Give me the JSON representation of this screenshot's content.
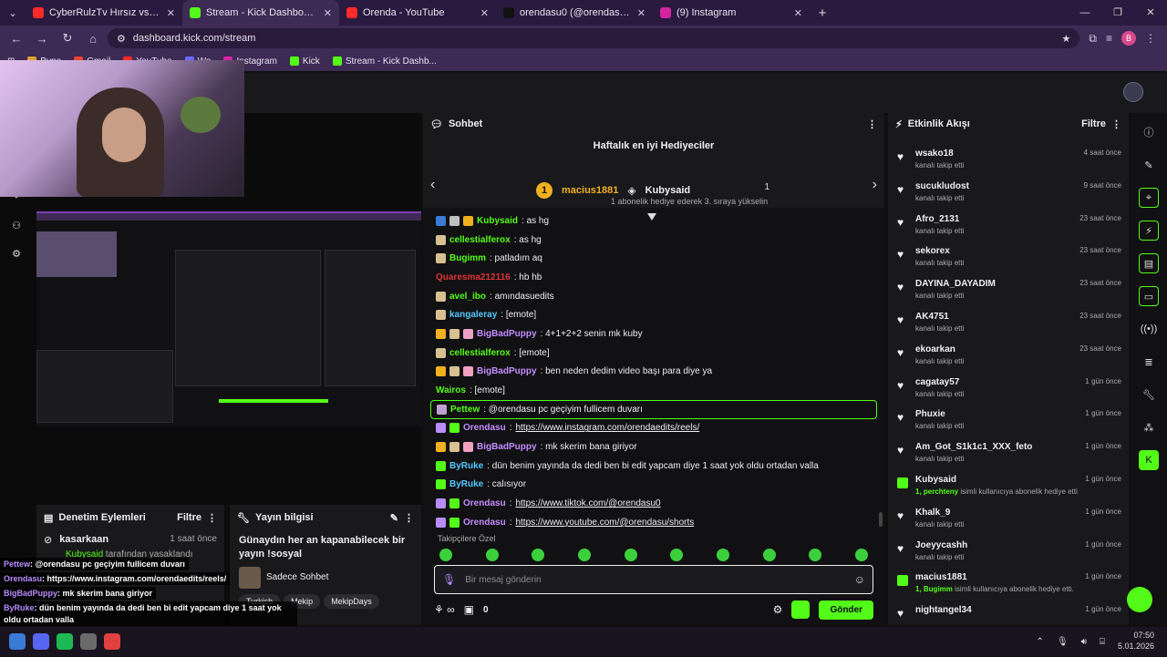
{
  "browser": {
    "tabs": [
      {
        "label": "CyberRulzTv Hırsız vs Polis Kom",
        "color": "#ff2a2a",
        "active": false
      },
      {
        "label": "Stream - Kick Dashboard",
        "color": "#53fc18",
        "active": true
      },
      {
        "label": "Orenda - YouTube",
        "color": "#ff2a2a",
        "active": false
      },
      {
        "label": "orendasu0 (@orendasu0) | TikT",
        "color": "#111111",
        "active": false
      },
      {
        "label": "(9) Instagram",
        "color": "#d6249f",
        "active": false
      }
    ],
    "new_tab": "+",
    "url": "dashboard.kick.com/stream",
    "profile_initial": "B",
    "bookmarks": [
      {
        "label": "Bypo",
        "color": "#e0a030"
      },
      {
        "label": "Gmail",
        "color": "#ea4335"
      },
      {
        "label": "YouTube",
        "color": "#ff2a2a"
      },
      {
        "label": "Wo",
        "color": "#6a6aff"
      },
      {
        "label": "Instagram",
        "color": "#d6249f"
      },
      {
        "label": "Kick",
        "color": "#53fc18"
      },
      {
        "label": "Stream - Kick Dashb...",
        "color": "#53fc18"
      }
    ]
  },
  "moderation": {
    "title": "Denetim Eylemleri",
    "filter": "Filtre",
    "item_name": "kasarkaan",
    "item_time": "1 saat önce",
    "item_desc_user": "Kubysaid",
    "item_desc": "tarafından yasaklandı"
  },
  "stream_info": {
    "title": "Yayın bilgisi",
    "stream_title": "Günaydın her an kapanabilecek bir yayın !sosyal",
    "category": "Sadece Sohbet",
    "tags": [
      "Turkish",
      "Mekip",
      "MekipDays"
    ]
  },
  "overlay_chat": [
    {
      "user": "Pettew",
      "text": ": @orendasu pc geçiyim fullicem duvarı"
    },
    {
      "user": "Orendasu",
      "text": ": https://www.instagram.com/orendaedits/reels/"
    },
    {
      "user": "BigBadPuppy",
      "text": ": mk skerim bana giriyor"
    },
    {
      "user": "ByRuke",
      "text": ": dün benim yayında da dedi ben bi edit yapcam diye 1 saat yok oldu ortadan valla"
    },
    {
      "user": "ByRuke",
      "text": ": calısıyor"
    },
    {
      "user": "Orendasu",
      "text": ": https://www.tiktok.com/@orendasu0"
    }
  ],
  "chat": {
    "title": "Sohbet",
    "gifters_title": "Haftalık en iyi Hediyeciler",
    "top_gifter": {
      "rank": "1",
      "name": "macius1881",
      "count": "1"
    },
    "second_gifter": {
      "name": "Kubysaid",
      "count": "1",
      "note": "1 abonelik hediye ederek 3. sıraya yükselin"
    },
    "messages": [
      {
        "user": "Kubysaid",
        "color": "#53fc18",
        "text": ": as hg",
        "badges": [
          "#3a7bd5",
          "#c0c0c0",
          "#f0b020"
        ]
      },
      {
        "user": "cellestialferox",
        "color": "#53fc18",
        "text": ": as hg",
        "badges": [
          "#d8c090"
        ]
      },
      {
        "user": "Bugimm",
        "color": "#53fc18",
        "text": ": patladım aq",
        "badges": [
          "#d8c090"
        ]
      },
      {
        "user": "Quaresma212116",
        "color": "#e0333a",
        "text": ": hb hb",
        "badges": []
      },
      {
        "user": "avel_ibo",
        "color": "#53fc18",
        "text": ": amındasuedits",
        "badges": [
          "#d8c090"
        ]
      },
      {
        "user": "kangaleray",
        "color": "#53c8ff",
        "text": ": [emote]",
        "badges": [
          "#d8c090"
        ]
      },
      {
        "user": "BigBadPuppy",
        "color": "#c58cff",
        "text": ": 4+1+2+2 senin mk kuby",
        "badges": [
          "#f0b020",
          "#d8c090",
          "#f0a0c0"
        ]
      },
      {
        "user": "cellestialferox",
        "color": "#53fc18",
        "text": ": [emote]",
        "badges": [
          "#d8c090"
        ]
      },
      {
        "user": "BigBadPuppy",
        "color": "#c58cff",
        "text": ": ben neden dedim video başı para diye ya",
        "badges": [
          "#f0b020",
          "#d8c090",
          "#f0a0c0"
        ]
      },
      {
        "user": "Wairos",
        "color": "#53fc18",
        "text": ": [emote]",
        "badges": []
      },
      {
        "user": "Pettew",
        "color": "#53fc18",
        "text": ": @orendasu pc geçiyim fullicem duvarı",
        "badges": [
          "#c0a0d0"
        ],
        "highlight": true
      },
      {
        "user": "Orendasu",
        "color": "#c58cff",
        "text": ": ",
        "link": "https://www.instagram.com/orendaedits/reels/",
        "badges": [
          "#b98cff",
          "#53fc18"
        ]
      },
      {
        "user": "BigBadPuppy",
        "color": "#c58cff",
        "text": ": mk skerim bana giriyor",
        "badges": [
          "#f0b020",
          "#d8c090",
          "#f0a0c0"
        ]
      },
      {
        "user": "ByRuke",
        "color": "#53c8ff",
        "text": ": dün benim yayında da dedi ben bi edit yapcam diye 1 saat yok oldu ortadan valla",
        "badges": [
          "#53fc18"
        ]
      },
      {
        "user": "ByRuke",
        "color": "#53c8ff",
        "text": ": calısıyor",
        "badges": [
          "#53fc18"
        ]
      },
      {
        "user": "Orendasu",
        "color": "#c58cff",
        "text": ": ",
        "link": "https://www.tiktok.com/@orendasu0",
        "badges": [
          "#b98cff",
          "#53fc18"
        ]
      },
      {
        "user": "Orendasu",
        "color": "#c58cff",
        "text": ": ",
        "link": "https://www.youtube.com/@orendasu/shorts",
        "badges": [
          "#b98cff",
          "#53fc18"
        ]
      }
    ],
    "emote_label": "Takipçilere Özel",
    "input_placeholder": "Bir mesaj gönderin",
    "footer_count": "0",
    "send_label": "Gönder"
  },
  "activity": {
    "title": "Etkinlik Akışı",
    "filter": "Filtre",
    "items": [
      {
        "type": "follow",
        "name": "wsako18",
        "desc": "kanalı takip etti",
        "time": "4 saat önce"
      },
      {
        "type": "follow",
        "name": "sucukludost",
        "desc": "kanalı takip etti",
        "time": "9 saat önce"
      },
      {
        "type": "follow",
        "name": "Afro_2131",
        "desc": "kanalı takip etti",
        "time": "23 saat önce"
      },
      {
        "type": "follow",
        "name": "sekorex",
        "desc": "kanalı takip etti",
        "time": "23 saat önce"
      },
      {
        "type": "follow",
        "name": "DAYINA_DAYADIM",
        "desc": "kanalı takip etti",
        "time": "23 saat önce"
      },
      {
        "type": "follow",
        "name": "AK4751",
        "desc": "kanalı takip etti",
        "time": "23 saat önce"
      },
      {
        "type": "follow",
        "name": "ekoarkan",
        "desc": "kanalı takip etti",
        "time": "23 saat önce"
      },
      {
        "type": "follow",
        "name": "cagatay57",
        "desc": "kanalı takip etti",
        "time": "1 gün önce"
      },
      {
        "type": "follow",
        "name": "Phuxie",
        "desc": "kanalı takip etti",
        "time": "1 gün önce"
      },
      {
        "type": "follow",
        "name": "Am_Got_S1k1c1_XXX_feto",
        "desc": "kanalı takip etti",
        "time": "1 gün önce"
      },
      {
        "type": "gift",
        "name": "Kubysaid",
        "desc_bold": "1, perchteny",
        "desc": "isimli kullanıcıya abonelik hediye etti.",
        "time": "1 gün önce"
      },
      {
        "type": "follow",
        "name": "Khalk_9",
        "desc": "kanalı takip etti",
        "time": "1 gün önce"
      },
      {
        "type": "follow",
        "name": "Joeyycashh",
        "desc": "kanalı takip etti",
        "time": "1 gün önce"
      },
      {
        "type": "gift",
        "name": "macius1881",
        "desc_bold": "1, Bugimm",
        "desc": "isimli kullanıcıya abonelik hediye etti.",
        "time": "1 gün önce"
      },
      {
        "type": "follow",
        "name": "nightangel34",
        "desc": "",
        "time": "1 gün önce"
      }
    ]
  },
  "taskbar": {
    "time": "07:50",
    "date": "5.01.2026"
  },
  "colors": {
    "kick_green": "#53fc18",
    "browser_purple": "#3d2a55",
    "panel": "#19191b"
  }
}
